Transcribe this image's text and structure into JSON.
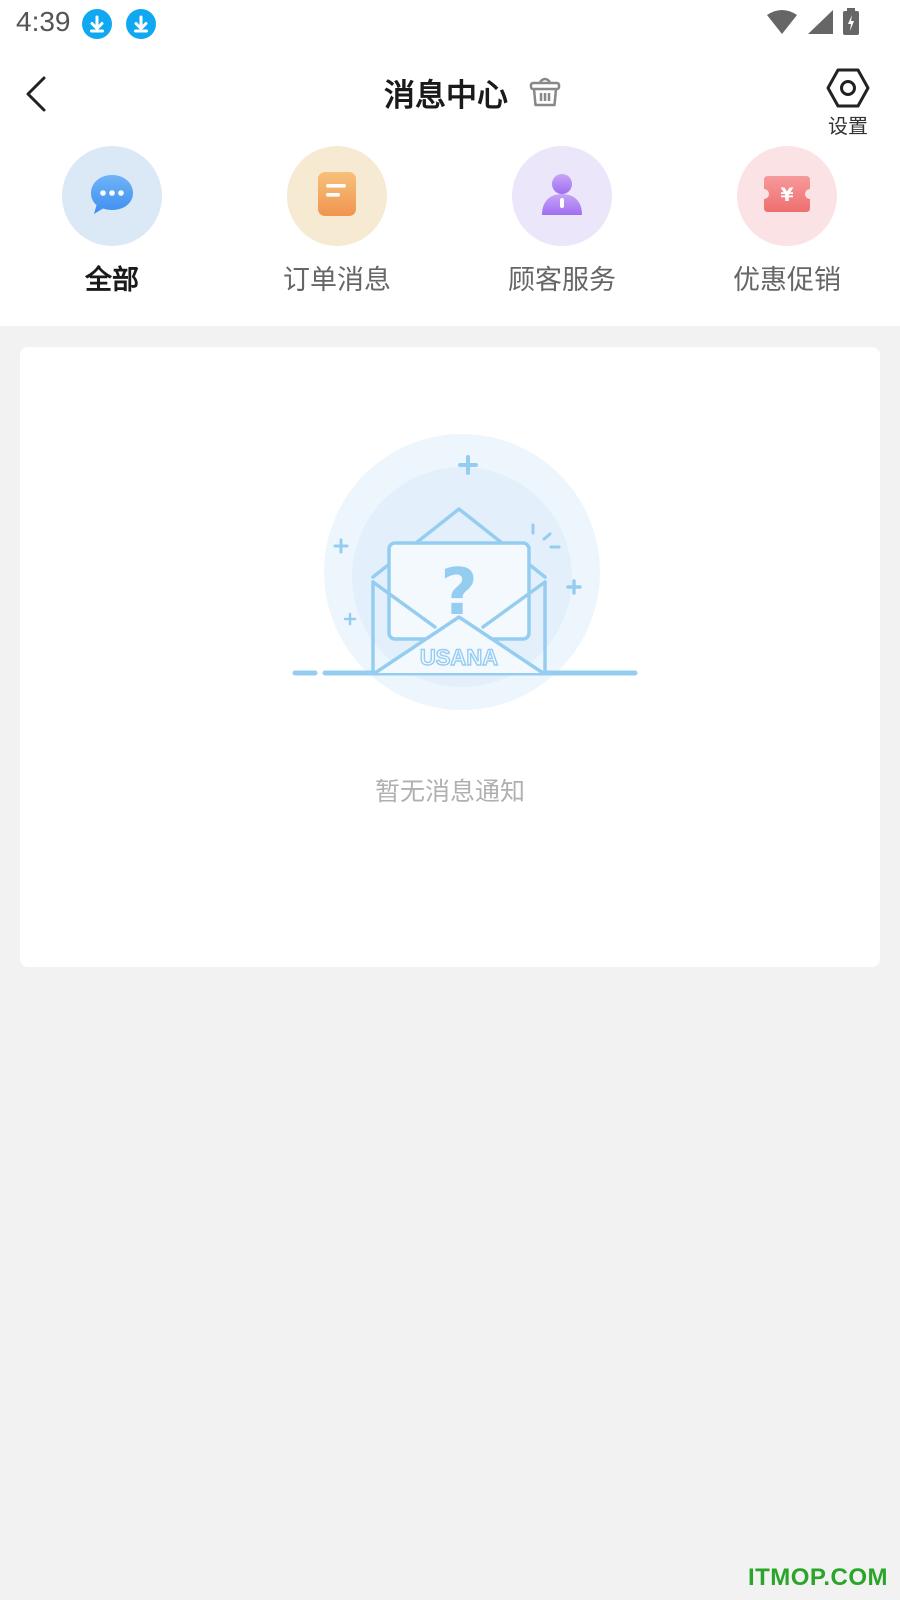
{
  "status_bar": {
    "time": "4:39"
  },
  "header": {
    "title": "消息中心",
    "settings_label": "设置"
  },
  "icons": {
    "back": "back-arrow-icon",
    "clear": "basket-icon",
    "settings": "hexagon-gear-icon"
  },
  "categories": [
    {
      "label": "全部",
      "icon": "chat-bubble-icon",
      "color": "#4a9af0",
      "bg": "#dbe8f6",
      "active": true
    },
    {
      "label": "订单消息",
      "icon": "document-icon",
      "color": "#f2a95a",
      "bg": "#f7ead3",
      "active": false
    },
    {
      "label": "顾客服务",
      "icon": "user-icon",
      "color": "#b58af0",
      "bg": "#ece6fa",
      "active": false
    },
    {
      "label": "优惠促销",
      "icon": "ticket-icon",
      "color": "#f07f7f",
      "bg": "#fbe3e5",
      "active": false
    }
  ],
  "empty_state": {
    "message": "暂无消息通知",
    "brand": "USANA"
  },
  "watermark": "ITMOP.COM",
  "colors": {
    "accent": "#10a8f0",
    "illustration": "#95cdf1"
  }
}
